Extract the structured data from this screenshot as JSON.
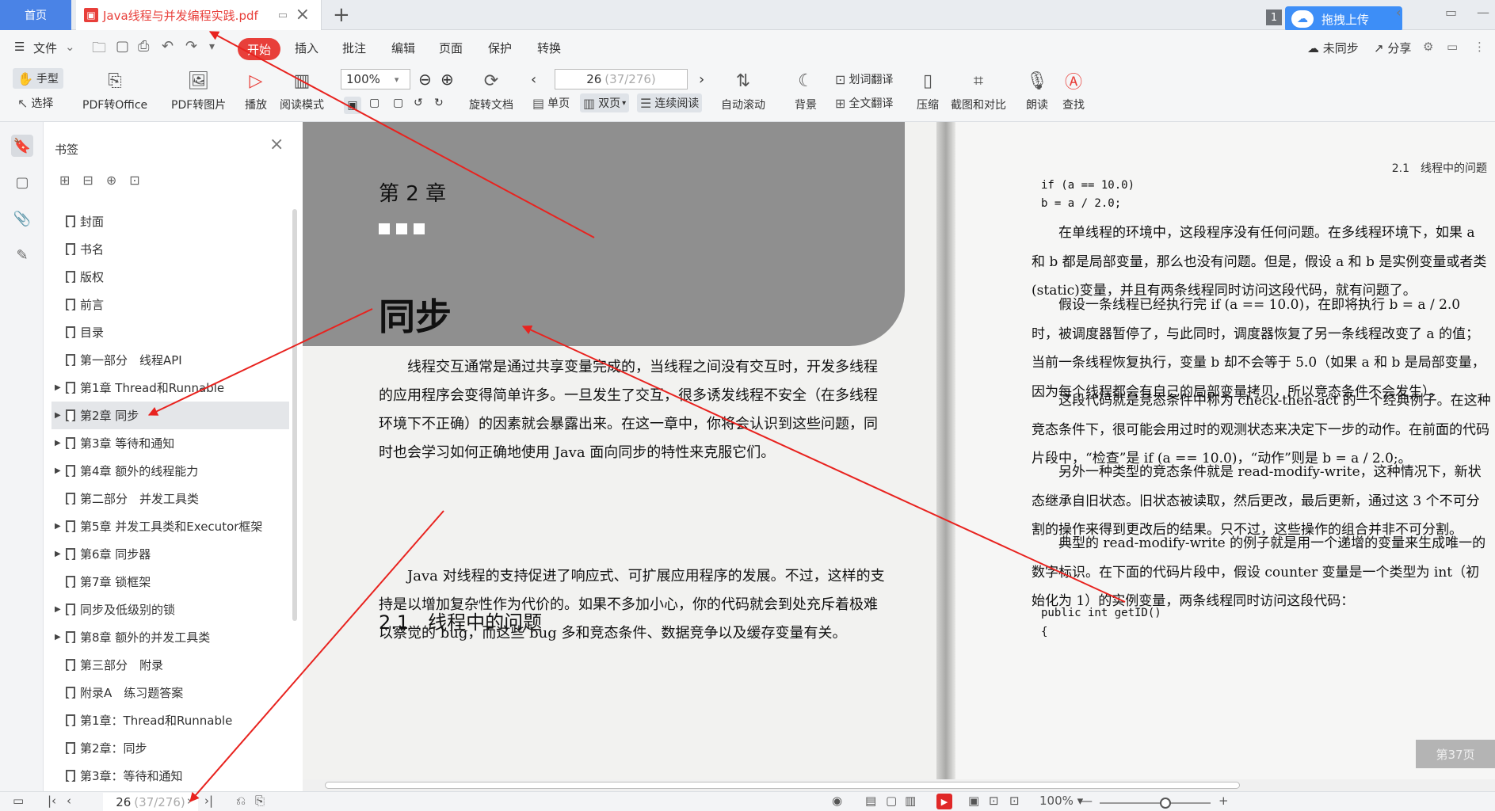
{
  "tabs": {
    "home": "首页",
    "doc_title": "Java线程与并发编程实践.pdf",
    "new_tab": "+"
  },
  "topright": {
    "count": "1",
    "upload": "拖拽上传"
  },
  "menu": {
    "file": "文件",
    "start": "开始",
    "insert": "插入",
    "annotate": "批注",
    "edit": "编辑",
    "page": "页面",
    "protect": "保护",
    "convert": "转换",
    "unsync": "未同步",
    "share": "分享"
  },
  "toolbar": {
    "hand": "手型",
    "select": "选择",
    "pdf_to_office": "PDF转Office",
    "pdf_to_image": "PDF转图片",
    "play": "播放",
    "read_mode": "阅读模式",
    "zoom": "100%",
    "rotate": "旋转文档",
    "page_current": "26",
    "page_total": "(37/276)",
    "single": "单页",
    "double": "双页",
    "continuous": "连续阅读",
    "auto_scroll": "自动滚动",
    "background": "背景",
    "word_translate": "划词翻译",
    "full_translate": "全文翻译",
    "compress": "压缩",
    "screenshot_compare": "截图和对比",
    "read_aloud": "朗读",
    "find": "查找"
  },
  "sidebar": {
    "title": "书签",
    "items": [
      {
        "label": "封面",
        "expandable": false,
        "selected": false
      },
      {
        "label": "书名",
        "expandable": false,
        "selected": false
      },
      {
        "label": "版权",
        "expandable": false,
        "selected": false
      },
      {
        "label": "前言",
        "expandable": false,
        "selected": false
      },
      {
        "label": "目录",
        "expandable": false,
        "selected": false
      },
      {
        "label": "第一部分　线程API",
        "expandable": false,
        "selected": false
      },
      {
        "label": "第1章 Thread和Runnable",
        "expandable": true,
        "selected": false
      },
      {
        "label": "第2章 同步",
        "expandable": true,
        "selected": true
      },
      {
        "label": "第3章 等待和通知",
        "expandable": true,
        "selected": false
      },
      {
        "label": "第4章 额外的线程能力",
        "expandable": true,
        "selected": false
      },
      {
        "label": "第二部分　并发工具类",
        "expandable": false,
        "selected": false
      },
      {
        "label": "第5章 并发工具类和Executor框架",
        "expandable": true,
        "selected": false
      },
      {
        "label": "第6章 同步器",
        "expandable": true,
        "selected": false
      },
      {
        "label": "第7章 锁框架",
        "expandable": false,
        "selected": false
      },
      {
        "label": "同步及低级别的锁",
        "expandable": true,
        "selected": false
      },
      {
        "label": "第8章 额外的并发工具类",
        "expandable": true,
        "selected": false
      },
      {
        "label": "第三部分　附录",
        "expandable": false,
        "selected": false
      },
      {
        "label": "附录A　练习题答案",
        "expandable": false,
        "selected": false
      },
      {
        "label": "第1章：Thread和Runnable",
        "expandable": false,
        "selected": false
      },
      {
        "label": "第2章：同步",
        "expandable": false,
        "selected": false
      },
      {
        "label": "第3章：等待和通知",
        "expandable": false,
        "selected": false
      }
    ]
  },
  "left_page": {
    "chapter": "第 2 章",
    "title": "同步",
    "para1": "线程交互通常是通过共享变量完成的，当线程之间没有交互时，开发多线程的应用程序会变得简单许多。一旦发生了交互，很多诱发线程不安全（在多线程环境下不正确）的因素就会暴露出来。在这一章中，你将会认识到这些问题，同时也会学习如何正确地使用 Java 面向同步的特性来克服它们。",
    "section": "2.1　线程中的问题",
    "para2": "Java 对线程的支持促进了响应式、可扩展应用程序的发展。不过，这样的支持是以增加复杂性作为代价的。如果不多加小心，你的代码就会到处充斥着极难以察觉的 bug，而这些 bug 多和竞态条件、数据竞争以及缓存变量有关。"
  },
  "right_page": {
    "header": "2.1　线程中的问题",
    "code1": "if (a == 10.0)",
    "code2": "  b = a / 2.0;",
    "p1": "在单线程的环境中，这段程序没有任何问题。在多线程环境下，如果 a 和 b 都是局部变量，那么也没有问题。但是，假设 a 和 b 是实例变量或者类(static)变量，并且有两条线程同时访问这段代码，就有问题了。",
    "p2": "假设一条线程已经执行完 if (a == 10.0)，在即将执行 b = a / 2.0 时，被调度器暂停了，与此同时，调度器恢复了另一条线程改变了 a 的值；当前一条线程恢复执行，变量 b 却不会等于 5.0（如果 a 和 b 是局部变量，因为每个线程都会有自己的局部变量拷贝，所以竞态条件不会发生）。",
    "p3": "这段代码就是竞态条件中称为 check-then-act 的一个经典例子。在这种竞态条件下，很可能会用过时的观测状态来决定下一步的动作。在前面的代码片段中，“检查”是 if (a == 10.0)，“动作”则是 b = a / 2.0;。",
    "p4": "另外一种类型的竞态条件就是 read-modify-write，这种情况下，新状态继承自旧状态。旧状态被读取，然后更改，最后更新，通过这 3 个不可分割的操作来得到更改后的结果。只不过，这些操作的组合并非不可分割。",
    "p5": "典型的 read-modify-write 的例子就是用一个递增的变量来生成唯一的数字标识。在下面的代码片段中，假设 counter 变量是一个类型为 int（初始化为 1）的实例变量，两条线程同时访问这段代码：",
    "code3": "public int getID()",
    "code4": "{",
    "page_indicator": "第37页"
  },
  "status": {
    "page_current": "26",
    "page_total": "(37/276)",
    "zoom": "100%"
  },
  "colors": {
    "accent_red": "#e83f3a",
    "brand_blue": "#4a83e6",
    "annotation_arrow": "#e8231f"
  }
}
